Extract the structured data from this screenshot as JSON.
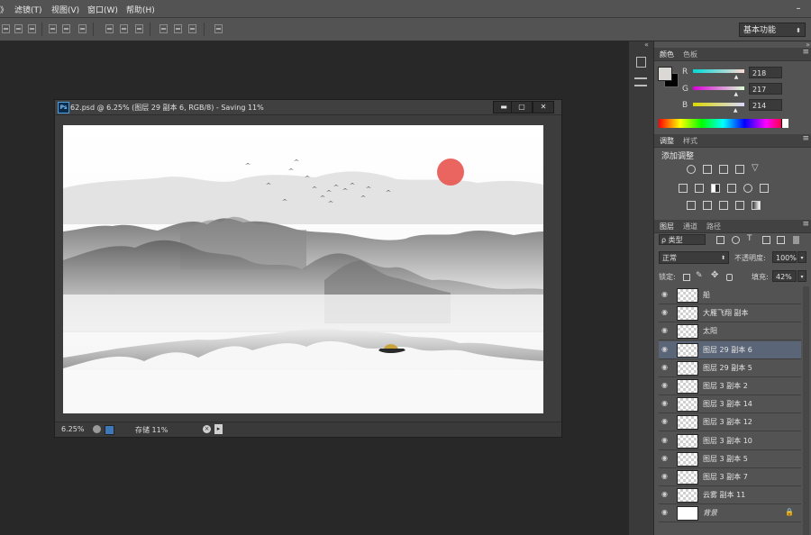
{
  "menubar": {
    "items": [
      "》",
      "滤镜(T)",
      "视图(V)",
      "窗口(W)",
      "帮助(H)"
    ],
    "win_control": "–"
  },
  "optbar": {
    "workspace": "基本功能"
  },
  "document": {
    "title": "62.psd @ 6.25% (图层 29 副本 6, RGB/8) - Saving 11%",
    "ps_icon": "Ps",
    "minimize": "▬",
    "maximize": "▢",
    "close": "✕",
    "zoom": "6.25%",
    "status": "存储 11%"
  },
  "color_panel": {
    "tabs": [
      "颜色",
      "色板"
    ],
    "channels": [
      {
        "label": "R",
        "value": "218",
        "level": 0.855
      },
      {
        "label": "G",
        "value": "217",
        "level": 0.851
      },
      {
        "label": "B",
        "value": "214",
        "level": 0.839
      }
    ],
    "foreground": "#dad9d6",
    "background": "#000000"
  },
  "adjust_panel": {
    "tabs": [
      "调整",
      "样式"
    ],
    "heading": "添加调整"
  },
  "layers_panel": {
    "tabs": [
      "图层",
      "通道",
      "路径"
    ],
    "filter": "ρ 类型",
    "blend_mode": "正常",
    "opacity_label": "不透明度:",
    "opacity_value": "100%",
    "lock_label": "锁定:",
    "fill_label": "填充:",
    "fill_value": "42%",
    "layers": [
      {
        "name": "船",
        "selected": false
      },
      {
        "name": "大雁飞翔 副本",
        "selected": false
      },
      {
        "name": "太阳",
        "selected": false
      },
      {
        "name": "图层 29 副本 6",
        "selected": true
      },
      {
        "name": "图层 29 副本 5",
        "selected": false
      },
      {
        "name": "图层 3 副本 2",
        "selected": false
      },
      {
        "name": "图层 3 副本 14",
        "selected": false
      },
      {
        "name": "图层 3 副本 12",
        "selected": false
      },
      {
        "name": "图层 3 副本 10",
        "selected": false
      },
      {
        "name": "图层 3 副本 5",
        "selected": false
      },
      {
        "name": "图层 3 副本 7",
        "selected": false
      },
      {
        "name": "云雾 副本 11",
        "selected": false
      },
      {
        "name": "背景",
        "selected": false
      }
    ],
    "lock_icon": "🔒"
  },
  "colors": {
    "sun": "#e8544e",
    "selected_row": "#5a6577",
    "panel": "#535353"
  }
}
